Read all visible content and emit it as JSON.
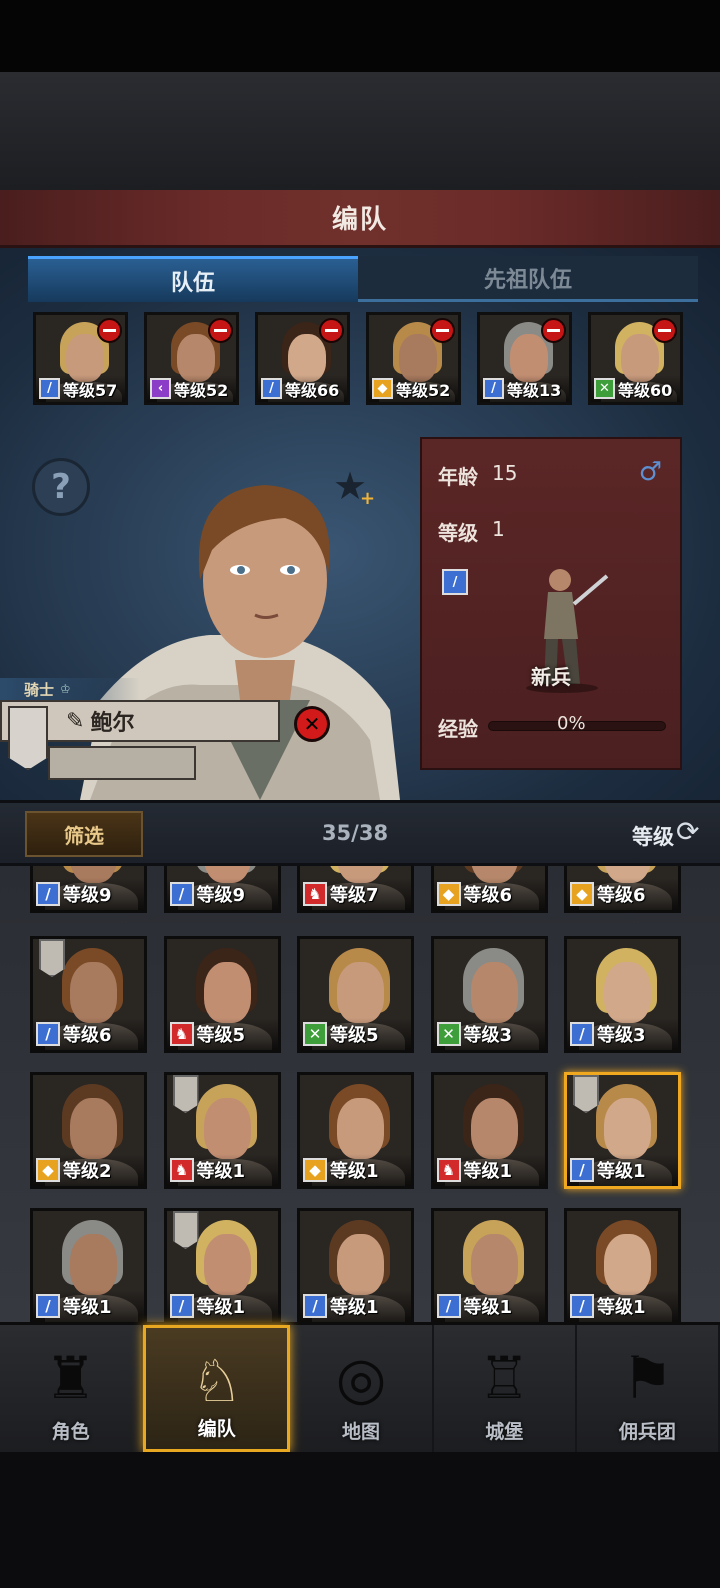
{
  "title": "编队",
  "tabs": [
    {
      "label": "队伍"
    },
    {
      "label": "先祖队伍"
    }
  ],
  "colors": {
    "accent": "#4aa3ff",
    "selected": "#f0a821",
    "danger": "#c51515"
  },
  "team": [
    {
      "level_label": "等级57",
      "class_icon": "sword-icon",
      "class_color": "#3c6fd1"
    },
    {
      "level_label": "等级52",
      "class_icon": "staff-icon",
      "class_color": "#8b3dc8"
    },
    {
      "level_label": "等级66",
      "class_icon": "sword-icon",
      "class_color": "#3c6fd1"
    },
    {
      "level_label": "等级52",
      "class_icon": "shield-icon",
      "class_color": "#e7a21f"
    },
    {
      "level_label": "等级13",
      "class_icon": "sword-icon",
      "class_color": "#3c6fd1"
    },
    {
      "level_label": "等级60",
      "class_icon": "bow-icon",
      "class_color": "#3e9e3a"
    }
  ],
  "info": {
    "age_label": "年龄",
    "age": "15",
    "level_label": "等级",
    "level": "1",
    "gender_icon": "male-icon",
    "gender_symbol": "♂",
    "unit_name": "新兵",
    "exp_label": "经验",
    "exp_value": "0%"
  },
  "hero": {
    "title": "骑士",
    "name": "鲍尔"
  },
  "filter": {
    "label": "筛选",
    "count": "35/38",
    "sort_label": "等级"
  },
  "roster": [
    {
      "level_label": "等级9",
      "class_icon": "sword-icon",
      "class_color": "#3c6fd1"
    },
    {
      "level_label": "等级9",
      "class_icon": "sword-icon",
      "class_color": "#3c6fd1"
    },
    {
      "level_label": "等级7",
      "class_icon": "horse-icon",
      "class_color": "#d22a2a"
    },
    {
      "level_label": "等级6",
      "class_icon": "shield-icon",
      "class_color": "#e7a21f"
    },
    {
      "level_label": "等级6",
      "class_icon": "shield-icon",
      "class_color": "#e7a21f"
    },
    {
      "level_label": "等级6",
      "class_icon": "sword-icon",
      "class_color": "#3c6fd1"
    },
    {
      "level_label": "等级5",
      "class_icon": "horse-icon",
      "class_color": "#d22a2a"
    },
    {
      "level_label": "等级5",
      "class_icon": "bow-icon",
      "class_color": "#3e9e3a"
    },
    {
      "level_label": "等级3",
      "class_icon": "bow-icon",
      "class_color": "#3e9e3a"
    },
    {
      "level_label": "等级3",
      "class_icon": "sword-icon",
      "class_color": "#3c6fd1"
    },
    {
      "level_label": "等级2",
      "class_icon": "shield-icon",
      "class_color": "#e7a21f"
    },
    {
      "level_label": "等级1",
      "class_icon": "horse-icon",
      "class_color": "#d22a2a"
    },
    {
      "level_label": "等级1",
      "class_icon": "shield-icon",
      "class_color": "#e7a21f"
    },
    {
      "level_label": "等级1",
      "class_icon": "horse-icon",
      "class_color": "#d22a2a"
    },
    {
      "level_label": "等级1",
      "class_icon": "sword-icon",
      "class_color": "#3c6fd1"
    },
    {
      "level_label": "等级1",
      "class_icon": "sword-icon",
      "class_color": "#3c6fd1"
    },
    {
      "level_label": "等级1",
      "class_icon": "sword-icon",
      "class_color": "#3c6fd1"
    },
    {
      "level_label": "等级1",
      "class_icon": "sword-icon",
      "class_color": "#3c6fd1"
    },
    {
      "level_label": "等级1",
      "class_icon": "sword-icon",
      "class_color": "#3c6fd1"
    },
    {
      "level_label": "等级1",
      "class_icon": "sword-icon",
      "class_color": "#3c6fd1"
    }
  ],
  "nav": [
    {
      "label": "角色",
      "icon": "knight-icon"
    },
    {
      "label": "编队",
      "icon": "helmet-icon"
    },
    {
      "label": "地图",
      "icon": "compass-icon"
    },
    {
      "label": "城堡",
      "icon": "castle-icon"
    },
    {
      "label": "佣兵团",
      "icon": "banner-icon"
    }
  ]
}
